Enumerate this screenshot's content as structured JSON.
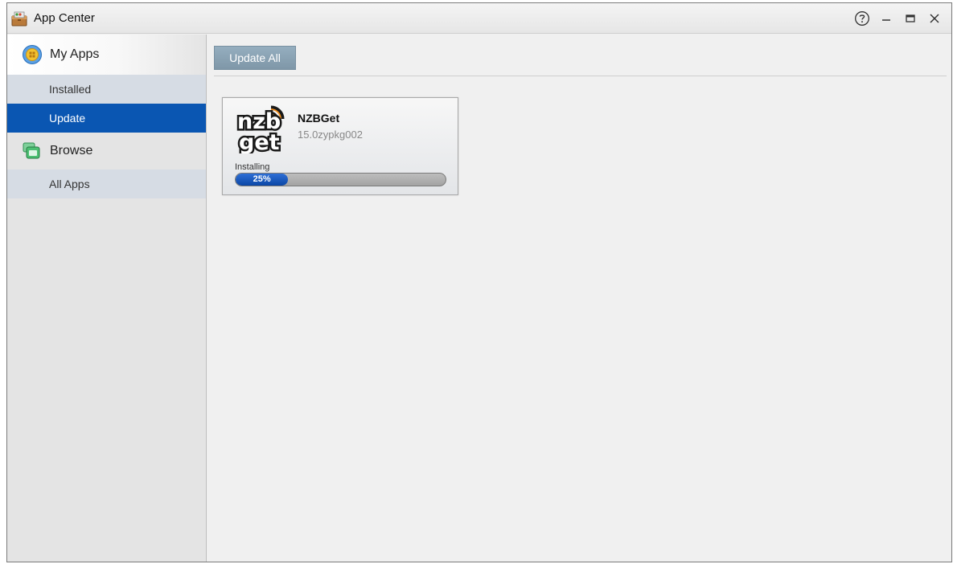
{
  "window": {
    "title": "App Center",
    "icon": "app-center-icon",
    "controls": [
      "help-icon",
      "minimize-icon",
      "maximize-icon",
      "close-icon"
    ]
  },
  "sidebar": {
    "my_apps": {
      "label": "My Apps",
      "icon": "my-apps-icon",
      "items": [
        {
          "label": "Installed",
          "active": false
        },
        {
          "label": "Update",
          "active": true
        }
      ]
    },
    "browse": {
      "label": "Browse",
      "icon": "browse-icon",
      "items": [
        {
          "label": "All Apps",
          "active": false
        }
      ]
    }
  },
  "main": {
    "update_all_label": "Update All",
    "apps": [
      {
        "name": "NZBGet",
        "version": "15.0zypkg002",
        "logo": "nzbget-logo",
        "status": "Installing",
        "progress_percent": 25,
        "progress_label": "25%"
      }
    ]
  },
  "colors": {
    "active_item": "#0a56b2",
    "progress_fill": "#0b47a6",
    "update_all_button": "#8aa2b3",
    "submenu_bg": "#d6dce4",
    "sidebar_bg": "#e4e4e4"
  }
}
